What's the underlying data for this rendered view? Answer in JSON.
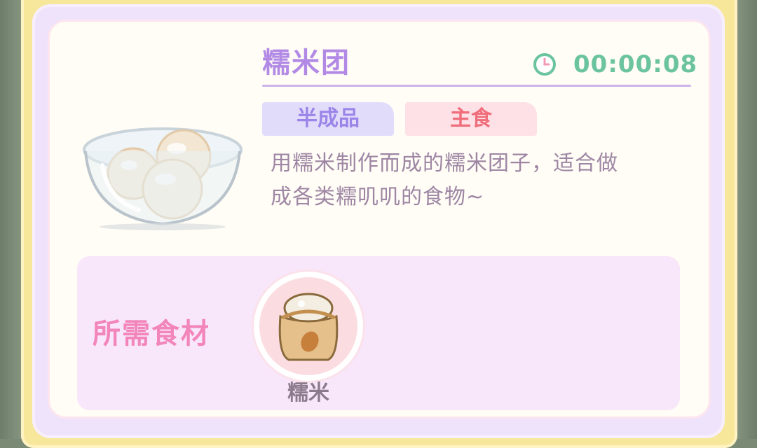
{
  "dish": {
    "name": "糯米团",
    "timer": "00:00:08",
    "tags": [
      "半成品",
      "主食"
    ],
    "description_lines": [
      "用糯米制作而成的糯米团子，适合做",
      "成各类糯叽叽的食物~"
    ],
    "icon": "rice-ball-bowl-icon"
  },
  "ingredients": {
    "title": "所需食材",
    "items": [
      {
        "name": "糯米",
        "icon": "rice-sack-icon"
      }
    ]
  },
  "colors": {
    "title": "#b28ae6",
    "timer": "#6bc3a0",
    "tag_semi": "#9b85e8",
    "tag_staple": "#f06e7b",
    "ingredient_title": "#f285b9"
  }
}
